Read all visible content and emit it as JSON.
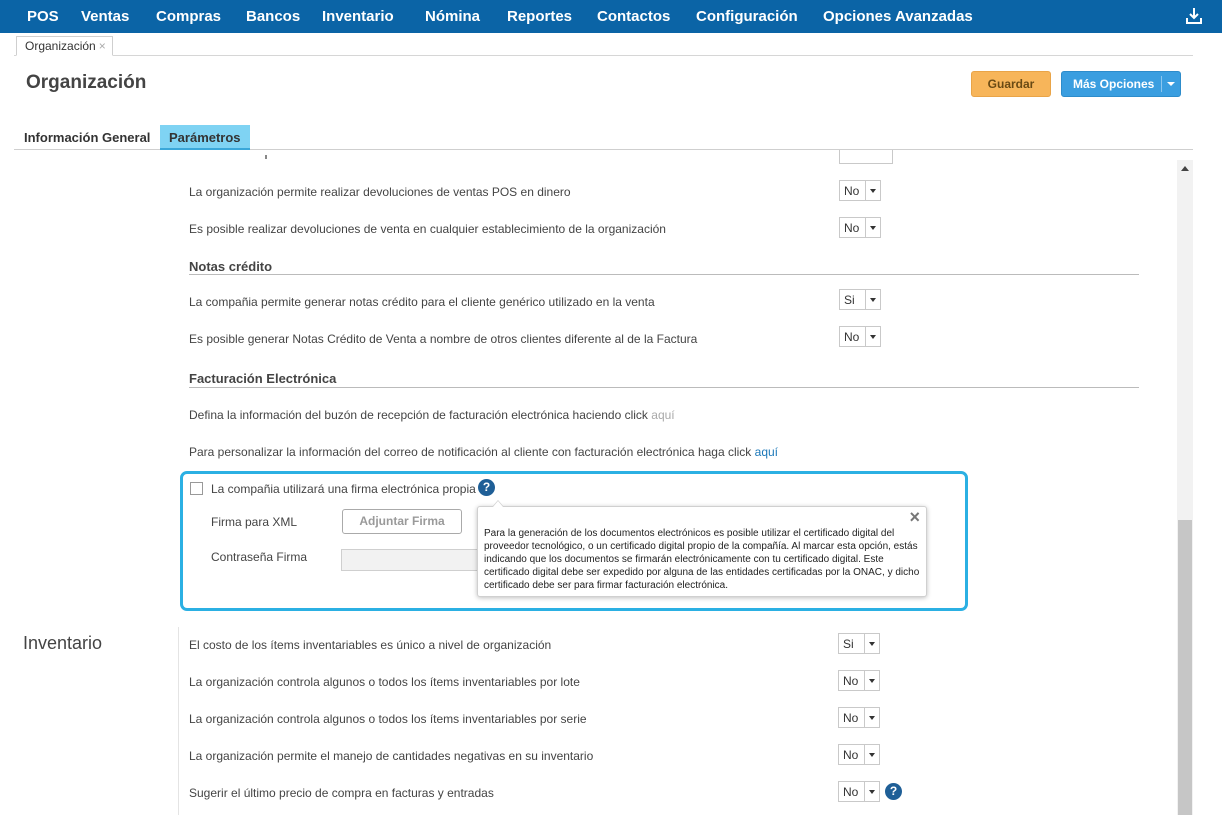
{
  "nav": {
    "items": [
      {
        "label": "POS"
      },
      {
        "label": "Ventas"
      },
      {
        "label": "Compras"
      },
      {
        "label": "Bancos"
      },
      {
        "label": "Inventario"
      },
      {
        "label": "Nómina"
      },
      {
        "label": "Reportes"
      },
      {
        "label": "Contactos"
      },
      {
        "label": "Configuración"
      },
      {
        "label": "Opciones Avanzadas"
      }
    ],
    "right_icon": "download-icon",
    "bg_color": "#0b64a6"
  },
  "doc_tab": {
    "label": "Organización",
    "close": "×"
  },
  "page": {
    "title": "Organización"
  },
  "actions": {
    "save_label": "Guardar",
    "more_label": "Más Opciones"
  },
  "section_tabs": [
    {
      "label": "Información General",
      "active": false
    },
    {
      "label": "Parámetros",
      "active": true
    }
  ],
  "pos_params": [
    {
      "text": "La organización permite realizar devoluciones de ventas POS en dinero",
      "value": "No"
    },
    {
      "text": "Es posible realizar devoluciones de venta en cualquier establecimiento de la organización",
      "value": "No"
    }
  ],
  "notas_credito": {
    "heading": "Notas crédito",
    "rows": [
      {
        "text": "La compañia permite generar notas crédito para el cliente genérico utilizado en la venta",
        "value": "Si"
      },
      {
        "text": "Es posible generar Notas Crédito de Venta a nombre de otros clientes diferente al de la Factura",
        "value": "No"
      }
    ]
  },
  "facturacion": {
    "heading": "Facturación Electrónica",
    "buzon_text": "Defina la información del buzón de recepción de facturación electrónica haciendo click",
    "buzon_link": "aquí",
    "correo_text": "Para personalizar la información del correo de notificación al cliente con facturación electrónica haga click",
    "correo_link": "aquí",
    "firma_checkbox_label": "La compañia utilizará una firma electrónica propia",
    "firma_checked": false,
    "firma_xml_label": "Firma para XML",
    "adjuntar_label": "Adjuntar Firma",
    "password_label": "Contraseña Firma",
    "help_glyph": "?",
    "tooltip_text": "Para la generación de los documentos electrónicos es posible utilizar el certificado digital del proveedor tecnológico, o un certificado digital propio de la compañía. Al marcar esta opción, estás indicando que los documentos se firmarán electrónicamente con tu certificado digital. Este certificado digital debe ser expedido por alguna de las entidades certificadas por la ONAC, y dicho certificado debe ser para firmar facturación electrónica.",
    "tooltip_close": "×"
  },
  "inventario": {
    "title": "Inventario",
    "rows": [
      {
        "text": "El costo de los ítems inventariables es único a nivel de organización",
        "value": "Si"
      },
      {
        "text": "La organización controla algunos o todos los ítems inventariables por lote",
        "value": "No"
      },
      {
        "text": "La organización controla algunos o todos los ítems inventariables por serie",
        "value": "No"
      },
      {
        "text": "La organización permite el manejo de cantidades negativas en su inventario",
        "value": "No"
      },
      {
        "text": "Sugerir el último precio de compra en facturas y entradas",
        "value": "No"
      }
    ],
    "help_glyph": "?"
  },
  "colors": {
    "accent": "#2bb0e3",
    "save": "#f7b55a",
    "more": "#3a9ee0",
    "link": "#1b77b8"
  }
}
